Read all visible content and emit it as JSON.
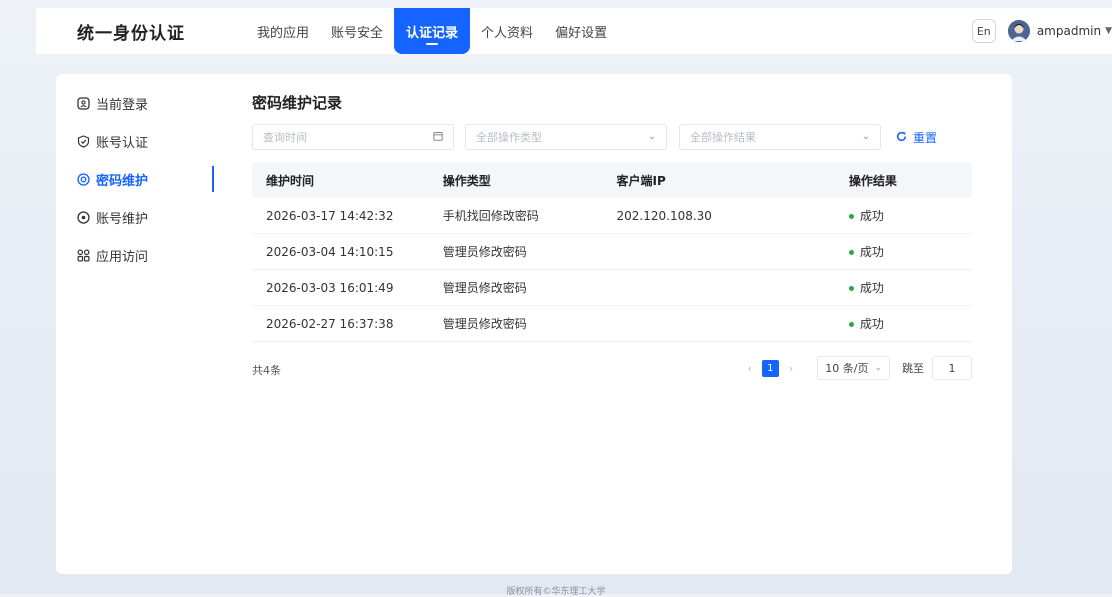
{
  "header": {
    "logo": "统一身份认证",
    "nav": [
      {
        "label": "我的应用"
      },
      {
        "label": "账号安全"
      },
      {
        "label": "认证记录",
        "active": true
      },
      {
        "label": "个人资料"
      },
      {
        "label": "偏好设置"
      }
    ],
    "lang": "En",
    "username": "ampadmin"
  },
  "sidebar": {
    "items": [
      {
        "label": "当前登录",
        "icon": "login-icon"
      },
      {
        "label": "账号认证",
        "icon": "shield-icon"
      },
      {
        "label": "密码维护",
        "icon": "password-icon",
        "active": true
      },
      {
        "label": "账号维护",
        "icon": "account-icon"
      },
      {
        "label": "应用访问",
        "icon": "apps-icon"
      }
    ]
  },
  "main": {
    "title": "密码维护记录",
    "filters": {
      "time_placeholder": "查询时间",
      "type_placeholder": "全部操作类型",
      "result_placeholder": "全部操作结果",
      "reset_label": "重置"
    },
    "table": {
      "columns": [
        "维护时间",
        "操作类型",
        "客户端IP",
        "操作结果"
      ],
      "rows": [
        {
          "time": "2026-03-17 14:42:32",
          "type": "手机找回修改密码",
          "ip": "202.120.108.30",
          "result": "成功"
        },
        {
          "time": "2026-03-04 14:10:15",
          "type": "管理员修改密码",
          "ip": "",
          "result": "成功"
        },
        {
          "time": "2026-03-03 16:01:49",
          "type": "管理员修改密码",
          "ip": "",
          "result": "成功"
        },
        {
          "time": "2026-02-27 16:37:38",
          "type": "管理员修改密码",
          "ip": "",
          "result": "成功"
        }
      ]
    },
    "pagination": {
      "total": "共4条",
      "current_page": "1",
      "page_size": "10 条/页",
      "jump_label": "跳至",
      "jump_value": "1"
    }
  },
  "footer": {
    "copyright": "版权所有©华东理工大学"
  },
  "colors": {
    "accent": "#1664ff",
    "success": "#2ba84a"
  }
}
